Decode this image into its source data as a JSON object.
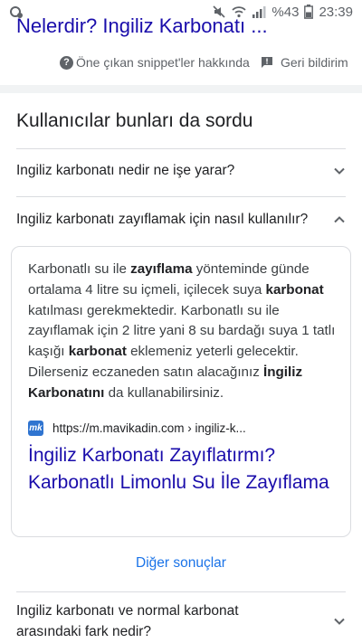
{
  "status_bar": {
    "battery": "%43",
    "time": "23:39",
    "icons": [
      "notification-icon",
      "mute-icon",
      "wifi-icon",
      "signal-icon",
      "battery-icon"
    ]
  },
  "top_result": {
    "title_fragment": "Nelerdir? İngiliz Karbonatı ..."
  },
  "snippet_footer": {
    "about_label": "Öne çıkan snippet'ler hakkında",
    "feedback_label": "Geri bildirim"
  },
  "people_also_ask": {
    "title": "Kullanıcılar bunları da sordu",
    "questions": [
      {
        "text": "Ingiliz karbonatı nedir ne işe yarar?",
        "expanded": false
      },
      {
        "text": "Ingiliz karbonatı zayıflamak için nasıl kullanılır?",
        "expanded": true
      }
    ],
    "answer": {
      "p1": "Karbonatlı su ile ",
      "b1": "zayıflama",
      "p2": " yönteminde günde ortalama 4 litre su içmeli, içilecek suya ",
      "b2": "karbonat",
      "p3": " katılması gerekmektedir. Karbonatlı su ile zayıflamak için 2 litre yani 8 su bardağı suya 1 tatlı kaşığı ",
      "b3": "karbonat",
      "p4": " eklemeniz yeterli gelecektir. Dilerseniz eczaneden satın alacağınız ",
      "b4": "İngiliz Karbonatını",
      "p5": " da kullanabilirsiniz.",
      "source_favicon_text": "mk",
      "source_url": "https://m.mavikadin.com › ingiliz-k...",
      "result_title": "İngiliz Karbonatı Zayıflatırmı? Karbonatlı Limonlu Su İle Zayıflama"
    },
    "more_results": "Diğer sonuçlar",
    "last_question": "Ingiliz karbonatı ve normal karbonat arasındaki fark nedir?"
  }
}
